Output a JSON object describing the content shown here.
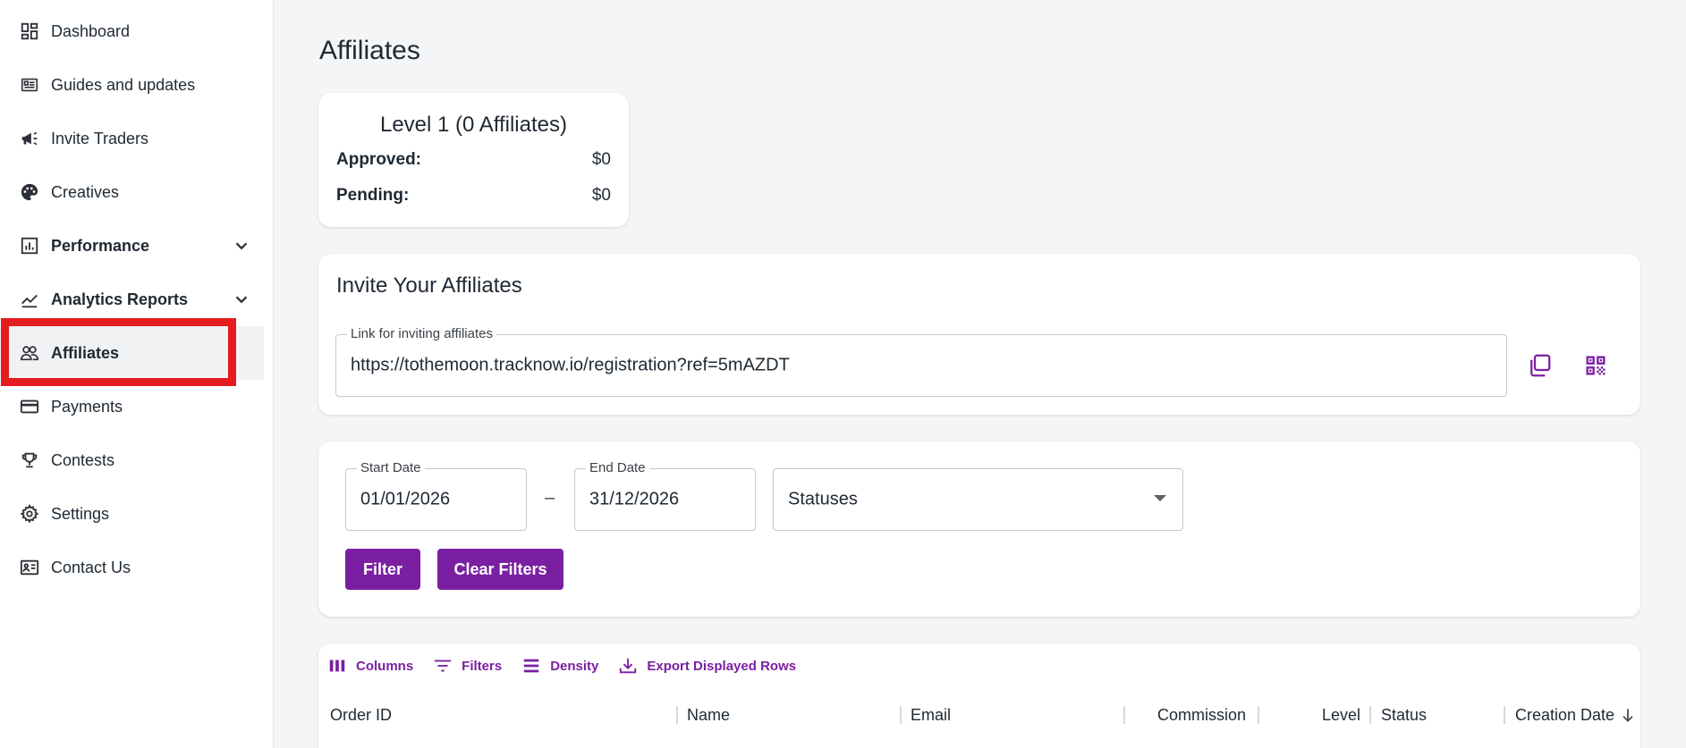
{
  "sidebar": {
    "items": [
      {
        "label": "Dashboard",
        "icon": "dashboard-icon"
      },
      {
        "label": "Guides and updates",
        "icon": "newspaper-icon"
      },
      {
        "label": "Invite Traders",
        "icon": "megaphone-icon"
      },
      {
        "label": "Creatives",
        "icon": "palette-icon"
      },
      {
        "label": "Performance",
        "icon": "bar-chart-icon",
        "expandable": true
      },
      {
        "label": "Analytics Reports",
        "icon": "line-chart-icon",
        "expandable": true
      },
      {
        "label": "Affiliates",
        "icon": "people-icon",
        "active": true
      },
      {
        "label": "Payments",
        "icon": "credit-card-icon"
      },
      {
        "label": "Contests",
        "icon": "trophy-icon"
      },
      {
        "label": "Settings",
        "icon": "gear-icon"
      },
      {
        "label": "Contact Us",
        "icon": "contact-card-icon"
      }
    ],
    "highlight_color": "#e51c1f"
  },
  "page": {
    "title": "Affiliates"
  },
  "level_card": {
    "title": "Level 1 (0 Affiliates)",
    "approved_label": "Approved:",
    "approved_value": "$0",
    "pending_label": "Pending:",
    "pending_value": "$0"
  },
  "invite": {
    "title": "Invite Your Affiliates",
    "link_label": "Link for inviting affiliates",
    "link_value": "https://tothemoon.tracknow.io/registration?ref=5mAZDT",
    "copy_icon": "copy-icon",
    "qr_icon": "qr-code-icon"
  },
  "filters": {
    "start_label": "Start Date",
    "start_value": "01/01/2026",
    "separator": "–",
    "end_label": "End Date",
    "end_value": "31/12/2026",
    "status_placeholder": "Statuses",
    "filter_button": "Filter",
    "clear_button": "Clear Filters"
  },
  "table": {
    "toolbar": {
      "columns": "Columns",
      "filters": "Filters",
      "density": "Density",
      "export": "Export Displayed Rows"
    },
    "columns": [
      "Order ID",
      "Name",
      "Email",
      "Commission",
      "Level",
      "Status",
      "Creation Date"
    ]
  },
  "colors": {
    "accent": "#7b1fa2",
    "background": "#f4f5f7"
  }
}
